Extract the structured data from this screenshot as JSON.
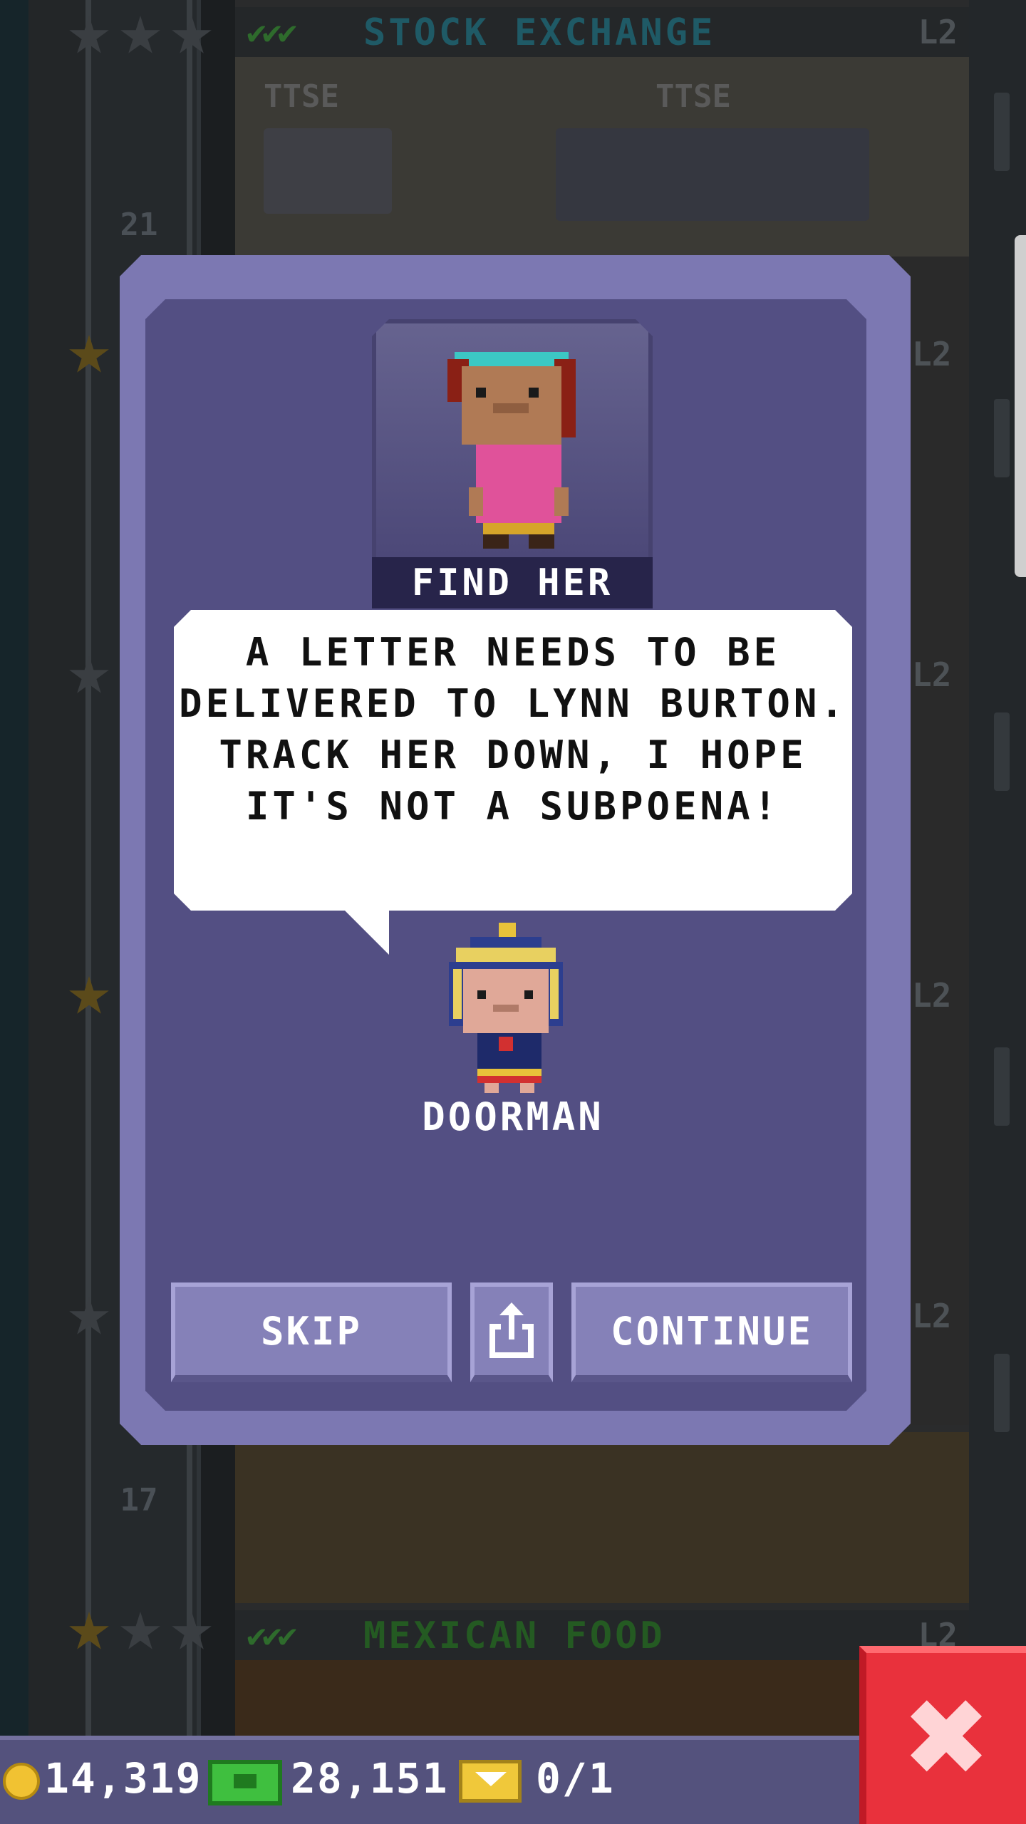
{
  "background": {
    "floors": [
      {
        "name": "STOCK EXCHANGE",
        "level": "L2",
        "color": "#1f5a66",
        "checks": "✔✔✔"
      },
      {
        "name": "MEXICAN FOOD",
        "level": "L2",
        "color": "#2e6b2c",
        "checks": "✔✔✔"
      }
    ],
    "floor_numbers": [
      "21",
      "17"
    ],
    "signs": [
      "TTSE",
      "TTSE"
    ],
    "side_levels": [
      "L2",
      "L2",
      "L2",
      "L2"
    ]
  },
  "dialog": {
    "portrait_label": "FIND HER",
    "message": "A LETTER NEEDS TO BE DELIVERED TO LYNN BURTON. TRACK HER DOWN, I HOPE IT'S NOT A SUBPOENA!",
    "npc_name": "DOORMAN",
    "buttons": {
      "skip": "SKIP",
      "continue": "CONTINUE"
    }
  },
  "bottom_bar": {
    "coins": "14,319",
    "bux": "28,151",
    "tickets": "0/1"
  },
  "icons": {
    "share": "share-icon",
    "close": "close-icon",
    "coin": "coin-icon",
    "bux": "bux-icon",
    "ticket": "ticket-icon"
  },
  "colors": {
    "dialog_outer": "#7c78b2",
    "dialog_inner": "#534f83",
    "button": "#8581b8",
    "close": "#e9313c"
  }
}
